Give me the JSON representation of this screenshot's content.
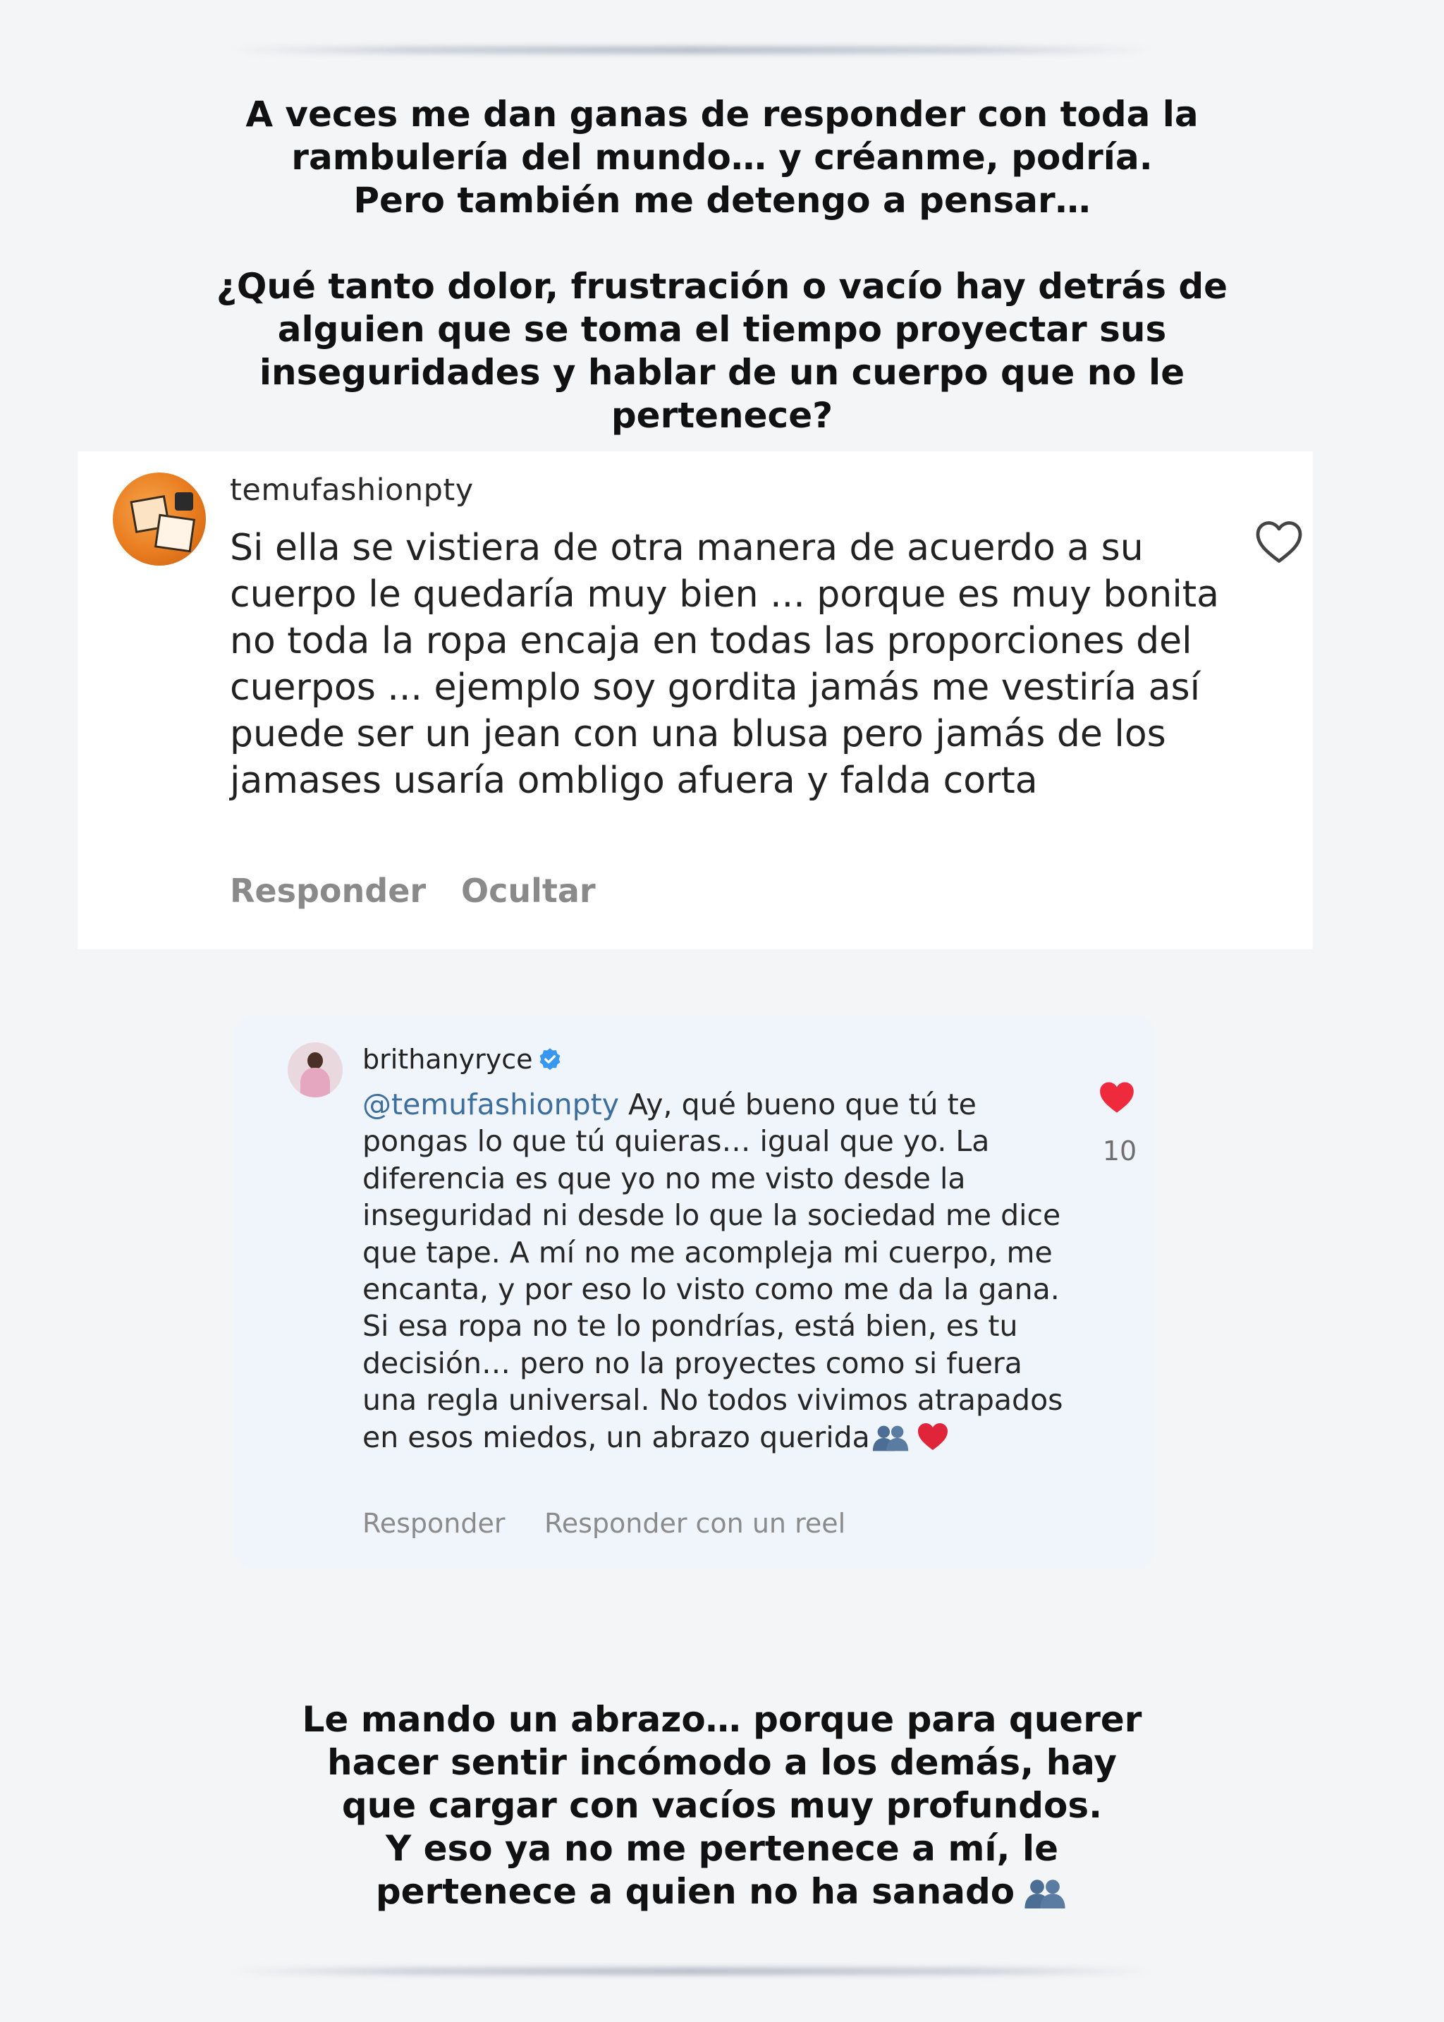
{
  "caption_top": "A veces me dan ganas de responder con toda la\nrambulería del mundo… y créanme, podría.\nPero también me detengo a pensar…\n\n¿Qué tanto dolor, frustración o vacío hay detrás de\nalguien que se toma el tiempo proyectar sus\ninseguridades y hablar de un cuerpo que no le\npertenece?",
  "comment": {
    "username": "temufashionpty",
    "text": "Si ella se vistiera de otra manera de acuerdo a su cuerpo le quedaría muy bien ... porque  es muy bonita no toda la ropa encaja en todas las proporciones del cuerpos ... ejemplo soy gordita jamás me vestiría así puede ser un jean con una blusa pero jamás de los jamases usaría ombligo afuera y falda corta",
    "reply_label": "Responder",
    "hide_label": "Ocultar",
    "avatar_icon": "temu-boxes-avatar",
    "like_icon": "heart-outline-icon"
  },
  "reply": {
    "username": "brithanyryce",
    "verified": true,
    "mention": "@temufashionpty",
    "text": " Ay, qué bueno que tú te pongas lo que tú quieras… igual que yo. La diferencia es que yo no me visto desde la inseguridad ni desde lo que la sociedad me dice que tape. A mí no me acompleja mi cuerpo, me encanta, y por eso lo visto como me da la gana. Si esa ropa no te lo pondrías, está bien, es tu decisión… pero no la proyectes como si fuera una regla universal. No todos vivimos atrapados en esos miedos, un abrazo querida",
    "like_count": "10",
    "reply_label": "Responder",
    "reel_label": "Responder con un reel",
    "like_color": "#ed2b3c",
    "mention_color": "#3c6e9e"
  },
  "caption_bottom": "Le mando un abrazo… porque para querer\nhacer sentir incómodo a los demás, hay\nque cargar con vacíos muy profundos.\nY eso ya no me pertenece a mí, le\npertenece a quien no ha sanado"
}
